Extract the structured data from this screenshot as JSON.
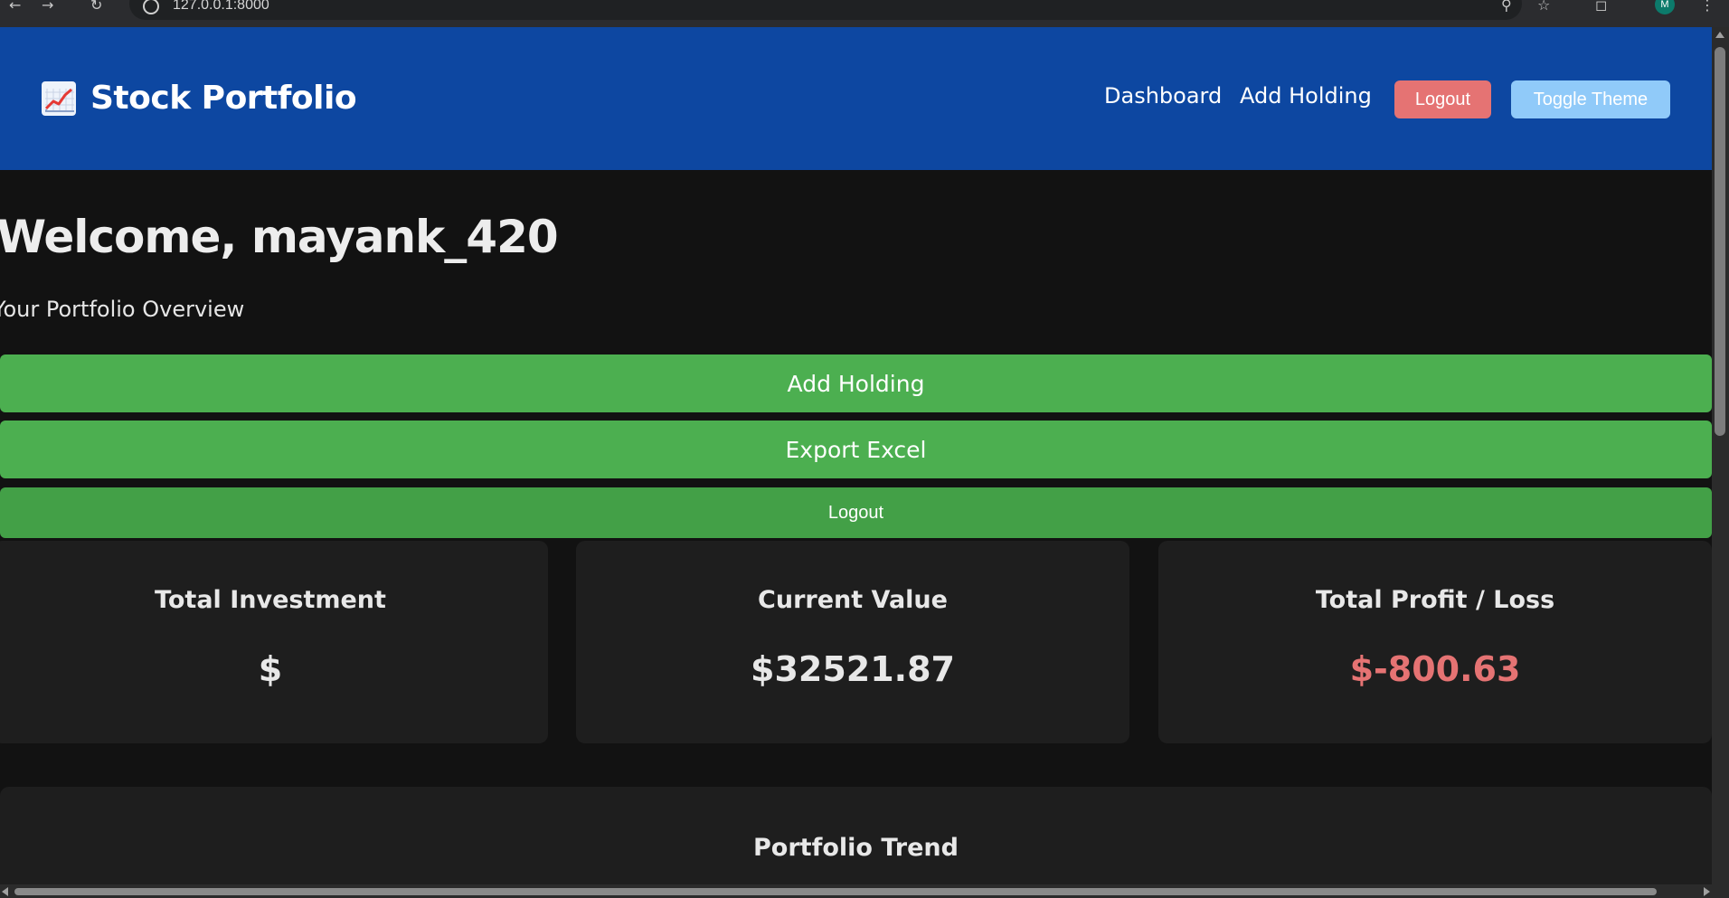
{
  "browser": {
    "url": "127.0.0.1:8000",
    "profile_initial": "M",
    "icons": [
      "back-icon",
      "forward-icon",
      "reload-icon",
      "site-info-icon",
      "zoom-icon",
      "bookmark-star-icon",
      "extensions-icon",
      "profile-avatar",
      "menu-icon"
    ]
  },
  "header": {
    "brand_icon": "chart-increasing-icon",
    "brand_title": "Stock Portfolio",
    "nav": {
      "dashboard": "Dashboard",
      "add_holding": "Add Holding",
      "logout": "Logout",
      "toggle_theme": "Toggle Theme"
    }
  },
  "main": {
    "welcome": "Welcome, mayank_420",
    "subtitle": "Your Portfolio Overview",
    "actions": {
      "add_holding": "Add Holding",
      "export_excel": "Export Excel",
      "logout": "Logout"
    },
    "cards": [
      {
        "title": "Total Investment",
        "value": "$"
      },
      {
        "title": "Current Value",
        "value": "$32521.87"
      },
      {
        "title": "Total Profit / Loss",
        "value": "$-800.63"
      }
    ],
    "trend_title": "Portfolio Trend"
  },
  "colors": {
    "header_bg": "#0d47a1",
    "page_bg": "#121212",
    "card_bg": "#1e1e1e",
    "action_green": "#4caf50",
    "logout_red": "#e57373",
    "toggle_blue": "#90caf9",
    "loss_red": "#e57373"
  }
}
